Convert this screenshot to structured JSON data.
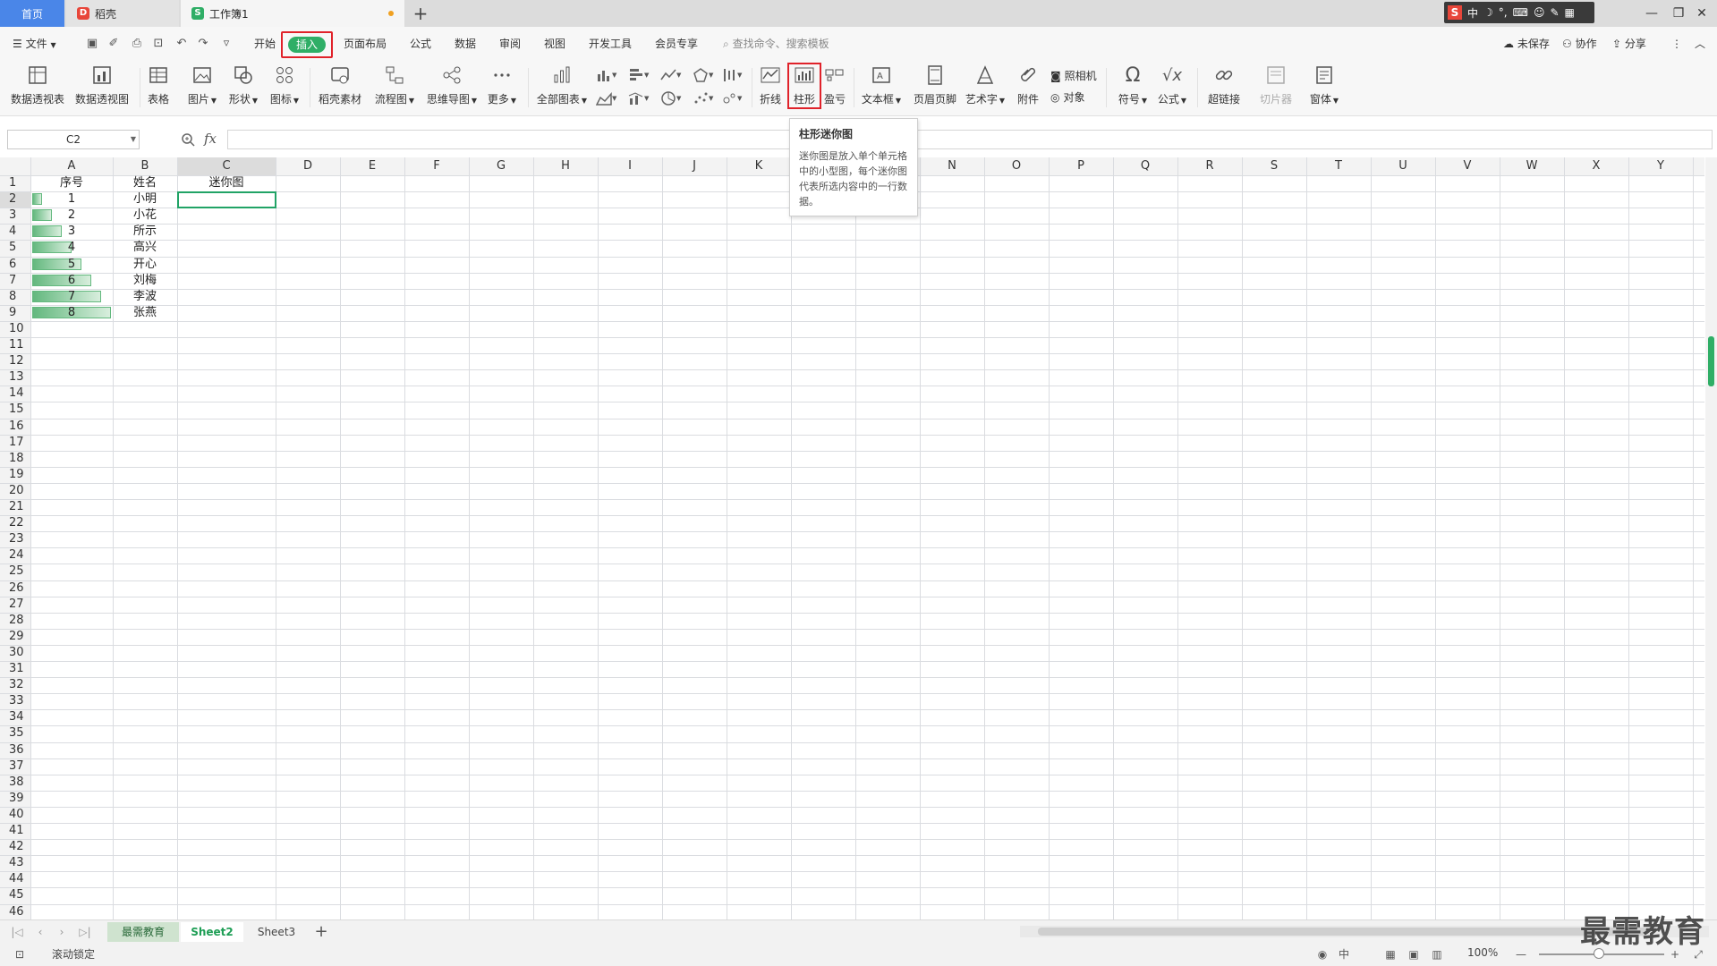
{
  "tabs": {
    "home": "首页",
    "daoke": "稻壳",
    "workbook": "工作簿1",
    "add": "+"
  },
  "ime": {
    "lang": "中"
  },
  "menu": {
    "file": "文件",
    "start": "开始",
    "insert": "插入",
    "page_layout": "页面布局",
    "formula": "公式",
    "data": "数据",
    "review": "审阅",
    "view": "视图",
    "dev_tools": "开发工具",
    "member": "会员专享",
    "search": "查找命令、搜索模板",
    "unsaved": "未保存",
    "collab": "协作",
    "share": "分享"
  },
  "ribbon": {
    "pivot_table": "数据透视表",
    "pivot_chart": "数据透视图",
    "table": "表格",
    "picture": "图片",
    "shape": "形状",
    "icon": "图标",
    "daoke_material": "稻壳素材",
    "flowchart": "流程图",
    "mindmap": "思维导图",
    "more": "更多",
    "all_charts": "全部图表",
    "line": "折线",
    "column": "柱形",
    "winloss": "盈亏",
    "textbox": "文本框",
    "header_footer": "页眉页脚",
    "wordart": "艺术字",
    "attachment": "附件",
    "camera": "照相机",
    "object": "对象",
    "symbol": "符号",
    "equation": "公式",
    "hyperlink": "超链接",
    "slicer": "切片器",
    "form": "窗体"
  },
  "tooltip": {
    "title": "柱形迷你图",
    "body": "迷你图是放入单个单元格中的小型图，每个迷你图代表所选内容中的一行数据。"
  },
  "formula_bar": {
    "name_box": "C2",
    "fx": "fx",
    "value": ""
  },
  "columns": [
    "A",
    "B",
    "C",
    "D",
    "E",
    "F",
    "G",
    "H",
    "I",
    "J",
    "K",
    "L",
    "M",
    "N",
    "O",
    "P",
    "Q",
    "R",
    "S",
    "T",
    "U",
    "V",
    "W",
    "X",
    "Y"
  ],
  "rows_count": 46,
  "sheet": {
    "headers": {
      "a": "序号",
      "b": "姓名",
      "c": "迷你图"
    },
    "records": [
      {
        "no": "1",
        "name": "小明",
        "bar": 0.125
      },
      {
        "no": "2",
        "name": "小花",
        "bar": 0.25
      },
      {
        "no": "3",
        "name": "所示",
        "bar": 0.375
      },
      {
        "no": "4",
        "name": "高兴",
        "bar": 0.5
      },
      {
        "no": "5",
        "name": "开心",
        "bar": 0.625
      },
      {
        "no": "6",
        "name": "刘梅",
        "bar": 0.75
      },
      {
        "no": "7",
        "name": "李波",
        "bar": 0.875
      },
      {
        "no": "8",
        "name": "张燕",
        "bar": 1.0
      }
    ]
  },
  "sheet_tabs": [
    "最需教育",
    "Sheet2",
    "Sheet3"
  ],
  "status": {
    "scroll_lock": "滚动锁定",
    "zoom": "100%"
  },
  "watermark": "最需教育",
  "colors": {
    "accent": "#2fae66",
    "highlight": "#e0222a",
    "home_tab": "#4a86e8"
  }
}
